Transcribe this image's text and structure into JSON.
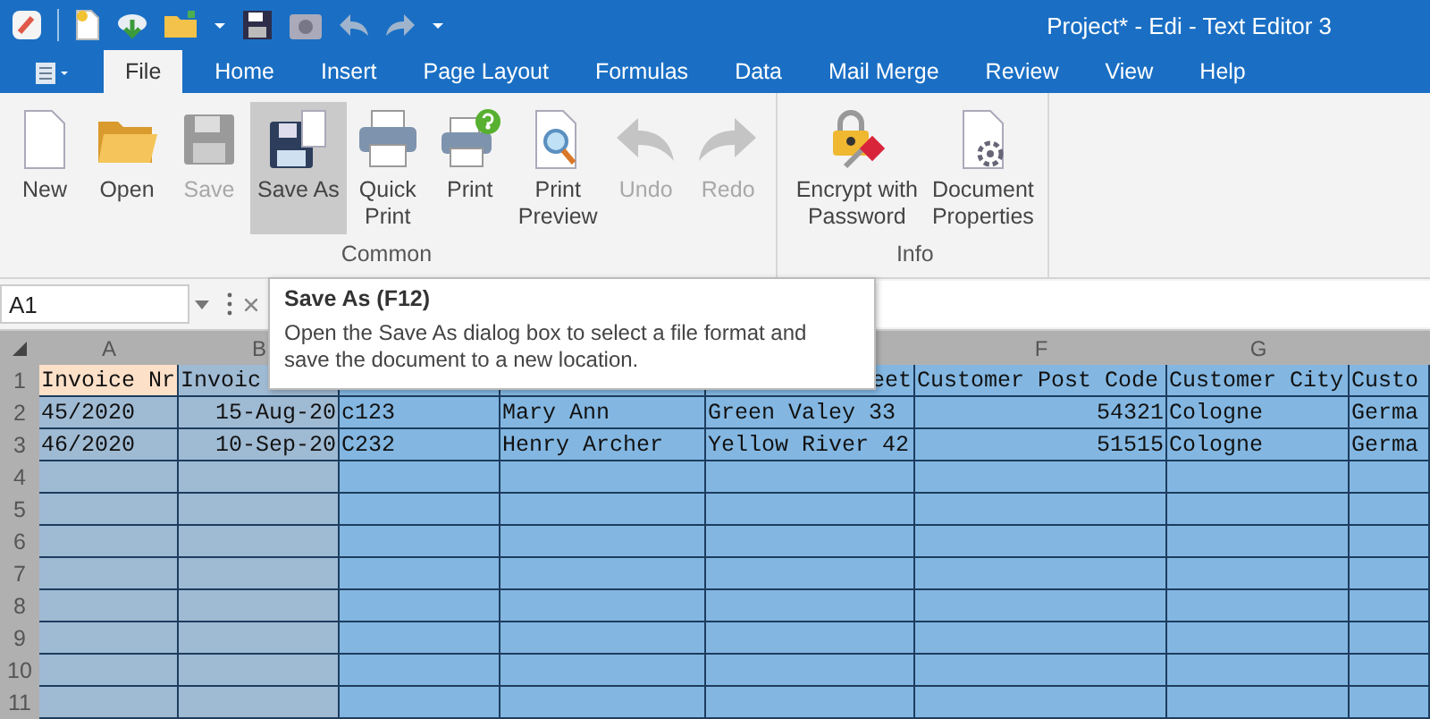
{
  "window": {
    "title": "Project* - Edi - Text Editor 3"
  },
  "quick_access": [
    {
      "kind": "app"
    },
    {
      "kind": "new"
    },
    {
      "kind": "download"
    },
    {
      "kind": "open"
    },
    {
      "kind": "caret"
    },
    {
      "kind": "save"
    },
    {
      "kind": "camera"
    },
    {
      "kind": "undo"
    },
    {
      "kind": "redo"
    },
    {
      "kind": "caret"
    }
  ],
  "tabs": [
    {
      "label": "File",
      "selected": true
    },
    {
      "label": "Home",
      "selected": false
    },
    {
      "label": "Insert",
      "selected": false
    },
    {
      "label": "Page Layout",
      "selected": false
    },
    {
      "label": "Formulas",
      "selected": false
    },
    {
      "label": "Data",
      "selected": false
    },
    {
      "label": "Mail Merge",
      "selected": false
    },
    {
      "label": "Review",
      "selected": false
    },
    {
      "label": "View",
      "selected": false
    },
    {
      "label": "Help",
      "selected": false
    }
  ],
  "ribbon": {
    "groups": [
      {
        "label": "Common",
        "buttons": [
          {
            "kind": "new",
            "label": "New",
            "disabled": false,
            "selected": false
          },
          {
            "kind": "open",
            "label": "Open",
            "disabled": false,
            "selected": false
          },
          {
            "kind": "save",
            "label": "Save",
            "disabled": true,
            "selected": false
          },
          {
            "kind": "saveas",
            "label": "Save As",
            "disabled": false,
            "selected": true
          },
          {
            "kind": "quickprint",
            "label": "Quick\nPrint",
            "disabled": false,
            "selected": false
          },
          {
            "kind": "print",
            "label": "Print",
            "disabled": false,
            "selected": false
          },
          {
            "kind": "preview",
            "label": "Print\nPreview",
            "disabled": false,
            "selected": false
          },
          {
            "kind": "undo",
            "label": "Undo",
            "disabled": true,
            "selected": false
          },
          {
            "kind": "redo",
            "label": "Redo",
            "disabled": true,
            "selected": false
          }
        ]
      },
      {
        "label": "Info",
        "buttons": [
          {
            "kind": "encrypt",
            "label": "Encrypt with\nPassword",
            "disabled": false,
            "selected": false
          },
          {
            "kind": "properties",
            "label": "Document\nProperties",
            "disabled": false,
            "selected": false
          }
        ]
      }
    ]
  },
  "formula_bar": {
    "name_box": "A1"
  },
  "tooltip": {
    "title": "Save As (F12)",
    "text": "Open the Save As dialog box to select a file format and save the document to a new location."
  },
  "sheet": {
    "columns": [
      {
        "header": "A"
      },
      {
        "header": "B"
      },
      {},
      {},
      {},
      {
        "header": "F"
      },
      {
        "header": "G"
      },
      {}
    ],
    "rows": [
      {
        "number": "1",
        "cells": [
          {
            "text": "Invoice Nr",
            "active": true
          },
          {
            "text": "Invoic"
          },
          {},
          {},
          {
            "text": "eet",
            "right_aligned": true
          },
          {
            "text": "Customer Post Code"
          },
          {
            "text": "Customer City"
          },
          {
            "text": "Custo"
          }
        ]
      },
      {
        "number": "2",
        "cells": [
          {
            "text": "45/2020"
          },
          {
            "text": "15-Aug-20",
            "right_aligned": true
          },
          {
            "text": "c123"
          },
          {
            "text": "Mary Ann"
          },
          {
            "text": "Green Valey 33"
          },
          {
            "text": "54321",
            "right_aligned": true
          },
          {
            "text": "Cologne"
          },
          {
            "text": "Germa"
          }
        ]
      },
      {
        "number": "3",
        "cells": [
          {
            "text": "46/2020"
          },
          {
            "text": "10-Sep-20",
            "right_aligned": true
          },
          {
            "text": "C232"
          },
          {
            "text": "Henry Archer"
          },
          {
            "text": "Yellow River 42"
          },
          {
            "text": "51515",
            "right_aligned": true
          },
          {
            "text": "Cologne"
          },
          {
            "text": "Germa"
          }
        ]
      },
      {
        "number": "4"
      },
      {
        "number": "5"
      },
      {
        "number": "6"
      },
      {
        "number": "7"
      },
      {
        "number": "8"
      },
      {
        "number": "9"
      },
      {
        "number": "10"
      },
      {
        "number": "11"
      }
    ]
  }
}
